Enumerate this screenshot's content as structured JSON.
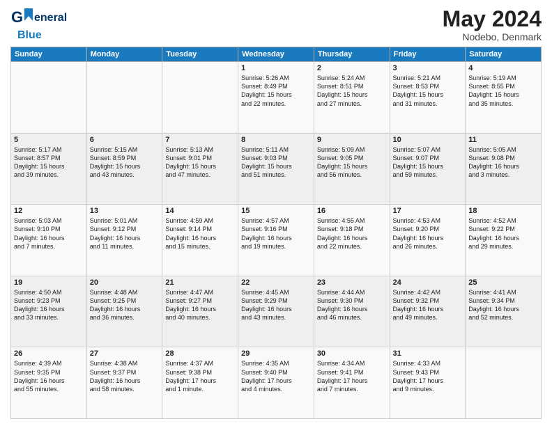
{
  "header": {
    "logo_general": "General",
    "logo_blue": "Blue",
    "month": "May 2024",
    "location": "Nodebo, Denmark"
  },
  "days_of_week": [
    "Sunday",
    "Monday",
    "Tuesday",
    "Wednesday",
    "Thursday",
    "Friday",
    "Saturday"
  ],
  "weeks": [
    [
      {
        "day": "",
        "info": ""
      },
      {
        "day": "",
        "info": ""
      },
      {
        "day": "",
        "info": ""
      },
      {
        "day": "1",
        "info": "Sunrise: 5:26 AM\nSunset: 8:49 PM\nDaylight: 15 hours\nand 22 minutes."
      },
      {
        "day": "2",
        "info": "Sunrise: 5:24 AM\nSunset: 8:51 PM\nDaylight: 15 hours\nand 27 minutes."
      },
      {
        "day": "3",
        "info": "Sunrise: 5:21 AM\nSunset: 8:53 PM\nDaylight: 15 hours\nand 31 minutes."
      },
      {
        "day": "4",
        "info": "Sunrise: 5:19 AM\nSunset: 8:55 PM\nDaylight: 15 hours\nand 35 minutes."
      }
    ],
    [
      {
        "day": "5",
        "info": "Sunrise: 5:17 AM\nSunset: 8:57 PM\nDaylight: 15 hours\nand 39 minutes."
      },
      {
        "day": "6",
        "info": "Sunrise: 5:15 AM\nSunset: 8:59 PM\nDaylight: 15 hours\nand 43 minutes."
      },
      {
        "day": "7",
        "info": "Sunrise: 5:13 AM\nSunset: 9:01 PM\nDaylight: 15 hours\nand 47 minutes."
      },
      {
        "day": "8",
        "info": "Sunrise: 5:11 AM\nSunset: 9:03 PM\nDaylight: 15 hours\nand 51 minutes."
      },
      {
        "day": "9",
        "info": "Sunrise: 5:09 AM\nSunset: 9:05 PM\nDaylight: 15 hours\nand 56 minutes."
      },
      {
        "day": "10",
        "info": "Sunrise: 5:07 AM\nSunset: 9:07 PM\nDaylight: 15 hours\nand 59 minutes."
      },
      {
        "day": "11",
        "info": "Sunrise: 5:05 AM\nSunset: 9:08 PM\nDaylight: 16 hours\nand 3 minutes."
      }
    ],
    [
      {
        "day": "12",
        "info": "Sunrise: 5:03 AM\nSunset: 9:10 PM\nDaylight: 16 hours\nand 7 minutes."
      },
      {
        "day": "13",
        "info": "Sunrise: 5:01 AM\nSunset: 9:12 PM\nDaylight: 16 hours\nand 11 minutes."
      },
      {
        "day": "14",
        "info": "Sunrise: 4:59 AM\nSunset: 9:14 PM\nDaylight: 16 hours\nand 15 minutes."
      },
      {
        "day": "15",
        "info": "Sunrise: 4:57 AM\nSunset: 9:16 PM\nDaylight: 16 hours\nand 19 minutes."
      },
      {
        "day": "16",
        "info": "Sunrise: 4:55 AM\nSunset: 9:18 PM\nDaylight: 16 hours\nand 22 minutes."
      },
      {
        "day": "17",
        "info": "Sunrise: 4:53 AM\nSunset: 9:20 PM\nDaylight: 16 hours\nand 26 minutes."
      },
      {
        "day": "18",
        "info": "Sunrise: 4:52 AM\nSunset: 9:22 PM\nDaylight: 16 hours\nand 29 minutes."
      }
    ],
    [
      {
        "day": "19",
        "info": "Sunrise: 4:50 AM\nSunset: 9:23 PM\nDaylight: 16 hours\nand 33 minutes."
      },
      {
        "day": "20",
        "info": "Sunrise: 4:48 AM\nSunset: 9:25 PM\nDaylight: 16 hours\nand 36 minutes."
      },
      {
        "day": "21",
        "info": "Sunrise: 4:47 AM\nSunset: 9:27 PM\nDaylight: 16 hours\nand 40 minutes."
      },
      {
        "day": "22",
        "info": "Sunrise: 4:45 AM\nSunset: 9:29 PM\nDaylight: 16 hours\nand 43 minutes."
      },
      {
        "day": "23",
        "info": "Sunrise: 4:44 AM\nSunset: 9:30 PM\nDaylight: 16 hours\nand 46 minutes."
      },
      {
        "day": "24",
        "info": "Sunrise: 4:42 AM\nSunset: 9:32 PM\nDaylight: 16 hours\nand 49 minutes."
      },
      {
        "day": "25",
        "info": "Sunrise: 4:41 AM\nSunset: 9:34 PM\nDaylight: 16 hours\nand 52 minutes."
      }
    ],
    [
      {
        "day": "26",
        "info": "Sunrise: 4:39 AM\nSunset: 9:35 PM\nDaylight: 16 hours\nand 55 minutes."
      },
      {
        "day": "27",
        "info": "Sunrise: 4:38 AM\nSunset: 9:37 PM\nDaylight: 16 hours\nand 58 minutes."
      },
      {
        "day": "28",
        "info": "Sunrise: 4:37 AM\nSunset: 9:38 PM\nDaylight: 17 hours\nand 1 minute."
      },
      {
        "day": "29",
        "info": "Sunrise: 4:35 AM\nSunset: 9:40 PM\nDaylight: 17 hours\nand 4 minutes."
      },
      {
        "day": "30",
        "info": "Sunrise: 4:34 AM\nSunset: 9:41 PM\nDaylight: 17 hours\nand 7 minutes."
      },
      {
        "day": "31",
        "info": "Sunrise: 4:33 AM\nSunset: 9:43 PM\nDaylight: 17 hours\nand 9 minutes."
      },
      {
        "day": "",
        "info": ""
      }
    ]
  ]
}
